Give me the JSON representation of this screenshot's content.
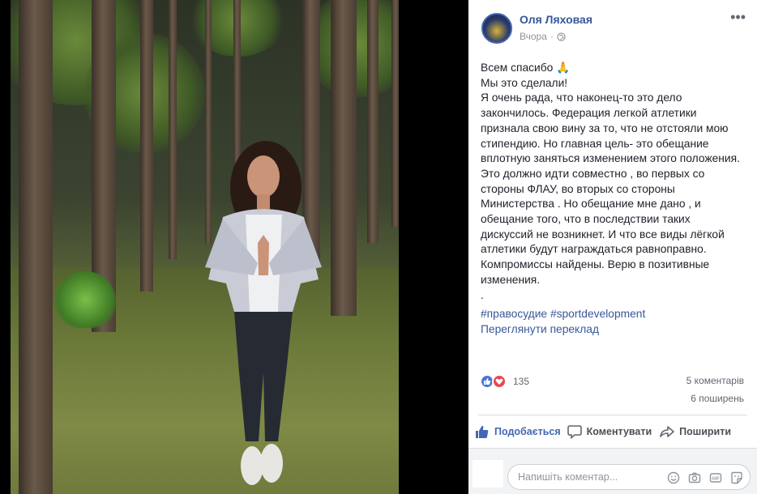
{
  "post": {
    "author": "Оля Ляховая",
    "time": "Вчора",
    "text_lines": [
      "Всем спасибо 🙏",
      "Мы это сделали!",
      "Я очень рада, что наконец-то это дело",
      "закончилось. Федерация легкой атлетики",
      "признала свою вину за то, что не отстояли мою",
      "стипендию. Но главная цель- это обещание",
      "вплотную заняться изменением этого положения.",
      "Это должно идти совместно , во первых со",
      "стороны ФЛАУ, во вторых со стороны",
      "Министерства . Но обещание мне дано , и",
      "обещание того, что в последствии таких",
      "дискуссий не возникнет. И что все виды лёгкой",
      "атлетики будут награждаться равноправно.",
      "Компромиссы найдены. Верю в позитивные",
      "изменения.",
      ".",
      "."
    ],
    "hashtags": "#правосудие #sportdevelopment",
    "translate_link": "Переглянути переклад"
  },
  "stats": {
    "reactions_count": "135",
    "comments": "5 коментарів",
    "shares": "6 поширень"
  },
  "actions": {
    "like": "Подобається",
    "comment": "Коментувати",
    "share": "Поширити"
  },
  "comment_box": {
    "placeholder": "Напишіть коментар..."
  },
  "icons": {
    "more": "more-icon",
    "privacy": "globe-icon",
    "like_reaction": "like-reaction-icon",
    "love_reaction": "love-reaction-icon",
    "emoji": "emoji-icon",
    "camera": "camera-icon",
    "gif": "gif-icon",
    "sticker": "sticker-icon"
  },
  "colors": {
    "link": "#385898",
    "like_blue": "#4267b2",
    "love_red": "#e8474f"
  }
}
